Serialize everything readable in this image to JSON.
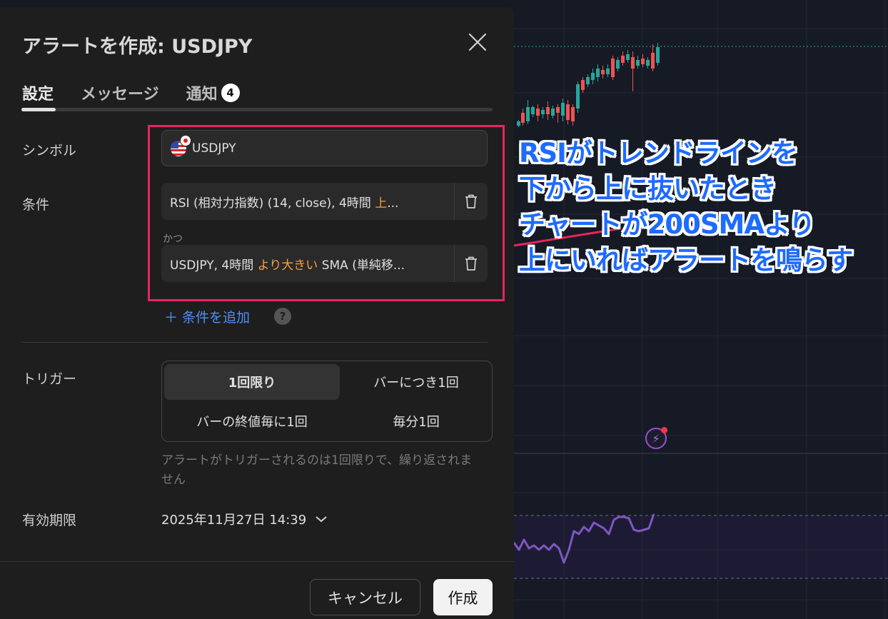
{
  "dialog": {
    "title": "アラートを作成: USDJPY",
    "tabs": [
      {
        "label": "設定",
        "active": true
      },
      {
        "label": "メッセージ",
        "active": false
      },
      {
        "label": "通知",
        "active": false,
        "badge": "4"
      }
    ],
    "symbol": {
      "label": "シンボル",
      "value": "USDJPY"
    },
    "conditions": {
      "label": "条件",
      "items": [
        {
          "text_before": "RSI (相対力指数) (14, close), 4時間 ",
          "operator": "上",
          "text_after": "..."
        },
        {
          "text_before": "USDJPY, 4時間 ",
          "operator": "より大きい",
          "text_after": " SMA (単純移..."
        }
      ],
      "joiner": "かつ",
      "add_label": "＋ 条件を追加",
      "help": "?"
    },
    "trigger": {
      "label": "トリガー",
      "options": [
        "1回限り",
        "バーにつき1回",
        "バーの終値毎に1回",
        "毎分1回"
      ],
      "selected": "1回限り",
      "hint": "アラートがトリガーされるのは1回限りで、繰り返されません"
    },
    "expiry": {
      "label": "有効期限",
      "value": "2025年11月27日 14:39"
    },
    "buttons": {
      "cancel": "キャンセル",
      "create": "作成"
    }
  },
  "annotation": {
    "lines": [
      "RSIがトレンドラインを",
      "下から上に抜いたとき",
      "チャートが200SMAより",
      "上にいればアラートを鳴らす"
    ],
    "color": "#1e6bff"
  },
  "colors": {
    "up": "#26a69a",
    "down": "#ef5350",
    "rsi": "#7e57c2",
    "accent_orange": "#f7a13b",
    "highlight_box": "#e8245e",
    "link": "#4f8ff7"
  }
}
